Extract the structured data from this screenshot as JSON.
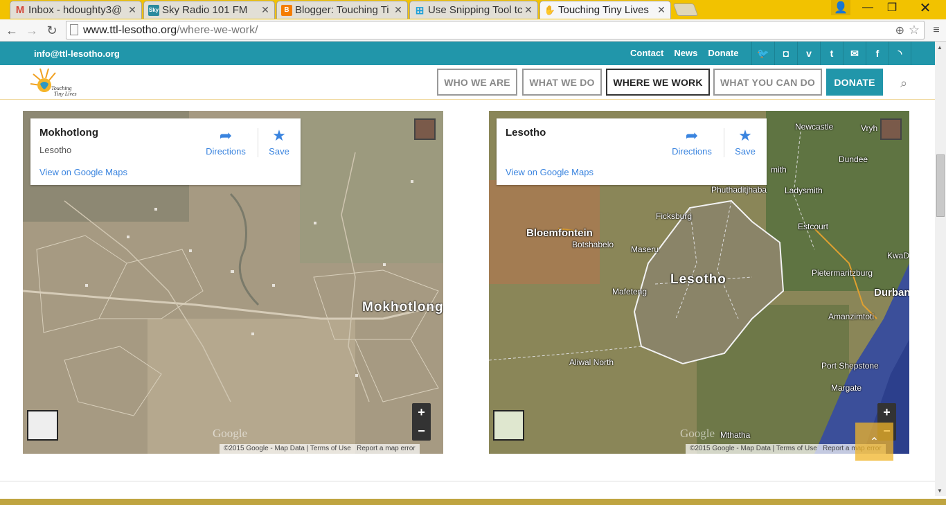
{
  "browser": {
    "tabs": [
      {
        "title": "Inbox - hdoughty3@",
        "icon": "gmail-icon",
        "color": "#d44638",
        "glyph": "M"
      },
      {
        "title": "Sky Radio 101 FM",
        "icon": "sky-radio-icon",
        "color": "#2b8a9e",
        "glyph": "Sky"
      },
      {
        "title": "Blogger: Touching Ti",
        "icon": "blogger-icon",
        "color": "#f57d00",
        "glyph": "B"
      },
      {
        "title": "Use Snipping Tool tc",
        "icon": "windows-icon",
        "color": "#1fa0d8",
        "glyph": "⊞"
      },
      {
        "title": "Touching Tiny Lives",
        "icon": "ttl-hand-icon",
        "color": "#2e98c4",
        "glyph": "✋"
      }
    ],
    "url_host": "www.ttl-lesotho.org",
    "url_path": "/where-we-work/"
  },
  "site": {
    "email": "info@ttl-lesotho.org",
    "top_links": [
      "Contact",
      "News",
      "Donate"
    ],
    "social_icons": [
      "twitter-icon",
      "instagram-icon",
      "vimeo-icon",
      "tumblr-icon",
      "mail-icon",
      "facebook-icon",
      "rss-icon"
    ],
    "logo_text": [
      "Touching",
      "Tiny Lives"
    ],
    "nav": [
      "WHO WE ARE",
      "WHAT WE DO",
      "WHERE WE WORK",
      "WHAT YOU CAN DO",
      "DONATE"
    ],
    "brand_color": "#2196aa"
  },
  "maps": [
    {
      "place": "Mokhotlong",
      "region": "Lesotho",
      "directions": "Directions",
      "save": "Save",
      "view_link": "View on Google Maps",
      "labels": [
        "Mokhotlong"
      ],
      "attribution": [
        "©2015 Google - Map Data",
        "Terms of Use",
        "Report a map error"
      ],
      "google": "Google"
    },
    {
      "place": "Lesotho",
      "region": "",
      "directions": "Directions",
      "save": "Save",
      "view_link": "View on Google Maps",
      "labels": [
        "Newcastle",
        "Vryh",
        "Dundee",
        "mith",
        "Phuthaditjhaba",
        "Ladysmith",
        "Ficksburg",
        "Estcourt",
        "Bloemfontein",
        "Botshabelo",
        "Maseru",
        "KwaD",
        "Pietermaritzburg",
        "Lesotho",
        "Mafeteng",
        "Durban",
        "Amanzimtoti",
        "Aliwal North",
        "Port Shepstone",
        "Margate",
        "Mthatha"
      ],
      "attribution": [
        "©2015 Google - Map Data",
        "Terms of Use",
        "Report a map error"
      ],
      "google": "Google"
    }
  ]
}
